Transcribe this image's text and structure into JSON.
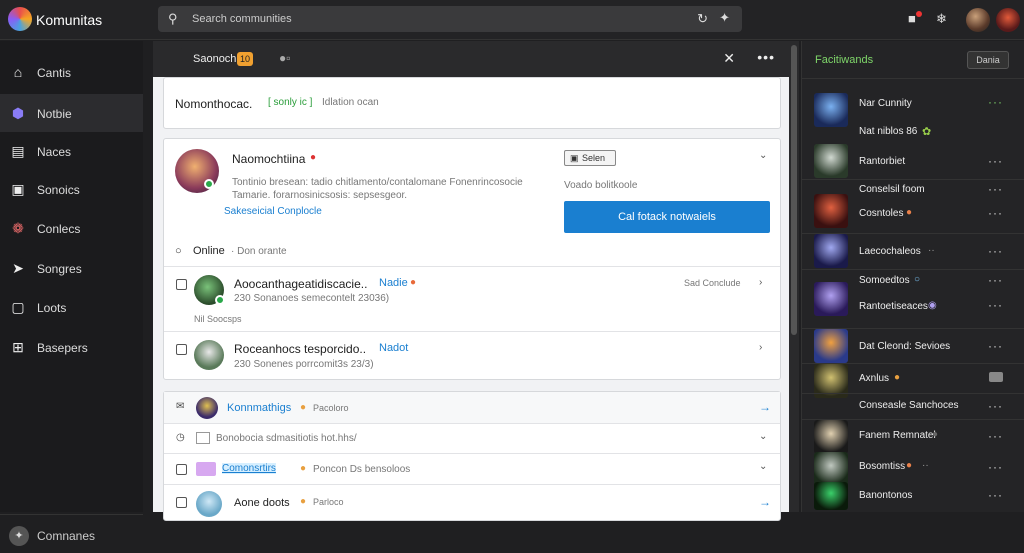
{
  "app": {
    "title": "Komunitas"
  },
  "search": {
    "placeholder": "Search communities"
  },
  "sidebar": {
    "items": [
      {
        "label": "Cantis",
        "icon": "home-icon",
        "active": false
      },
      {
        "label": "Notbie",
        "icon": "hexagon-icon",
        "active": true
      },
      {
        "label": "Naces",
        "icon": "list-icon",
        "active": false
      },
      {
        "label": "Sonoics",
        "icon": "folder-icon",
        "active": false
      },
      {
        "label": "Conlecs",
        "icon": "apps-icon",
        "active": false
      },
      {
        "label": "Songres",
        "icon": "tag-icon",
        "active": false
      },
      {
        "label": "Loots",
        "icon": "box-icon",
        "active": false
      },
      {
        "label": "Basepers",
        "icon": "grid-icon",
        "active": false
      }
    ],
    "bottom": {
      "label": "Comnanes",
      "icon": "settings-icon"
    }
  },
  "header": {
    "name": "Saonoch",
    "badge": "10",
    "more_label": "•••"
  },
  "notification": {
    "text": "Nomonthocac.",
    "tag": "[ sonly ic ]",
    "detail": "Idlation ocan"
  },
  "profile": {
    "name": "Naomochtiina",
    "bio_line1": "Tontinio bresean: tadio chitlamento/contalomane Fonenrincosocie",
    "bio_line2": "Tamarie. forarnosinicsosis: sepsesgeor.",
    "link": "Sakeseicial Conplocle",
    "select_label": "Selen",
    "select_caption": "Voado bolitkoole",
    "primary_button": "Cal fotack notwaiels",
    "status_label": "Online",
    "status_detail": "· Don orante"
  },
  "rows": [
    {
      "title": "Aoocanthageatidiscacie..",
      "tag": "Nadie",
      "sub": "230 Sonanoes semecontelt 23036)",
      "extra": "Nil Soocsps",
      "meta": "Sad Conclude"
    },
    {
      "title": "Roceanhocs tesporcido..",
      "tag": "Nadot",
      "sub": "230 Sonenes porrcomit3s 23/3)",
      "extra": "",
      "meta": ""
    }
  ],
  "list": [
    {
      "title": "Konnmathigs",
      "tag": "Pacoloro"
    },
    {
      "title": "Bonobocia sdmasitiotis hot.hhs/",
      "tag": ""
    },
    {
      "title": "Comonsrtirs",
      "tag": "Poncon Ds bensoloos"
    },
    {
      "title": "Aone doots",
      "tag": "Parloco"
    }
  ],
  "rpanel": {
    "title": "Facitiwands",
    "button": "Dania",
    "items": [
      {
        "name": "Nar Cunnity"
      },
      {
        "name": "Nat niblos 86"
      },
      {
        "name": "Rantorbiet"
      },
      {
        "name": "Conselsil foom"
      },
      {
        "name": "Cosntoles"
      },
      {
        "name": "Laecochaleos"
      },
      {
        "name": "Somoedtos"
      },
      {
        "name": "Rantoetiseaces"
      },
      {
        "name": "Dat Cleond: Sevioes"
      },
      {
        "name": "Axnlus"
      },
      {
        "name": "Conseasle Sanchoces"
      },
      {
        "name": "Fanem Remnatel"
      },
      {
        "name": "Bosomtiss"
      },
      {
        "name": "Banontonos"
      }
    ]
  }
}
